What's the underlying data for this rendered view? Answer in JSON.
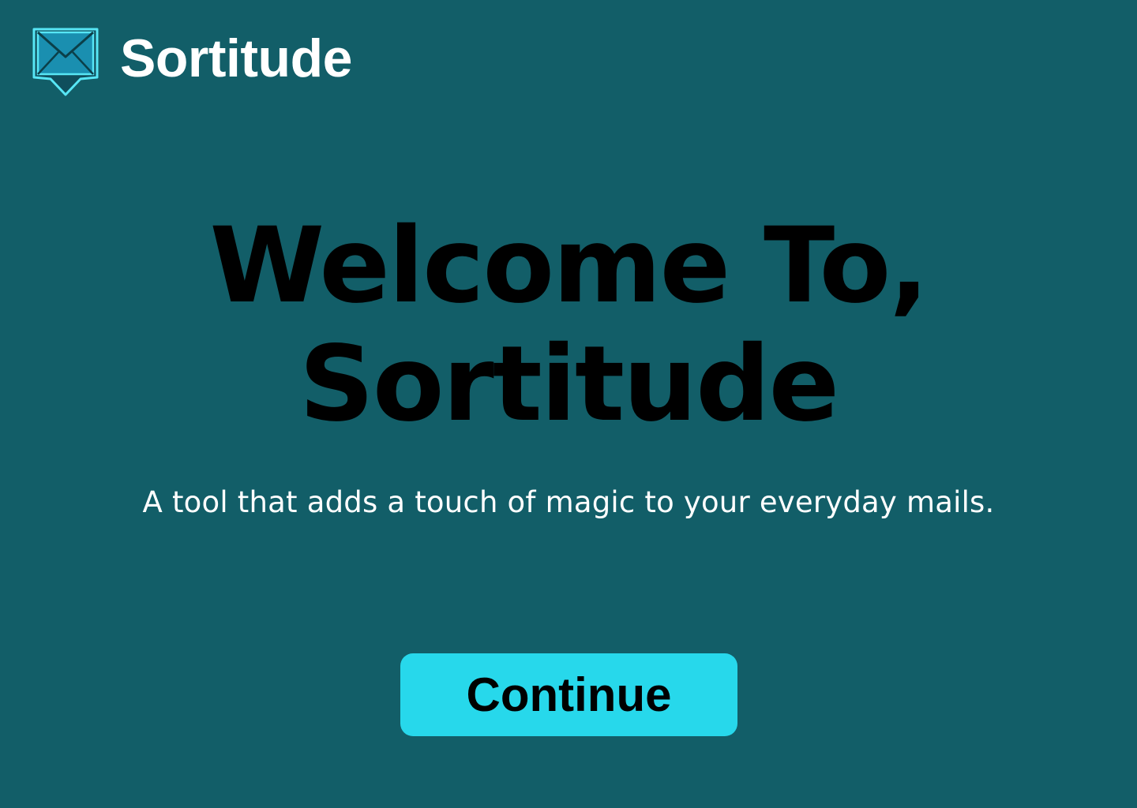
{
  "header": {
    "app_name": "Sortitude",
    "logo_icon": "envelope-icon"
  },
  "hero": {
    "headline_line1": "Welcome To,",
    "headline_line2": "Sortitude",
    "tagline": "A tool that adds a touch of magic to your everyday mails."
  },
  "actions": {
    "continue_label": "Continue"
  },
  "colors": {
    "background": "#125e68",
    "accent": "#27d8eb",
    "logo_fill": "#1a8fb0",
    "logo_stroke": "#57e6f5"
  }
}
